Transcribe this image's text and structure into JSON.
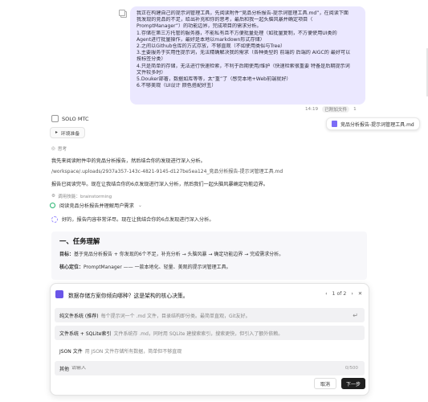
{
  "user_message": {
    "lines": [
      "我正在构建自己的提示词管理工具，先阅读附件“竞品分析报告-提示词管理工具.md”，在阅读下面",
      "我发现的竞品的不足，给出补充和你的思考，最后和我一起头脑风暴并确定项目（",
      "PromptManager”）的功能边界，完成项目的需求分析。",
      "1.存储在第三方托管的服务器，不能私有且不方便批量处理（如批量复制，不方便使用UI类的",
      "Agent进行批量操作，最好是本地以markdown形式存储）",
      "2.之间以Github仓库的方式存放，不够直观（不如使用类似与Tree）",
      "3.主要服务于实用性提示词，无法精确解决我的需求（各种类型的 前端的 后端的 AIGC的 最好可以",
      "按标签分类）",
      "4.只是简单的存储，无法进行快速检索，不利于后期使用/维护（快速检索很重要 特备是后期提示词",
      "文件较多时）",
      "5.Douker部署，数据如库等等，太“重”了（感觉本地+Web前端就好）",
      "6.不够美观（UI设计 颜色搭配好丑）"
    ],
    "time": "14:19",
    "badge": "已附加文件",
    "count": "1",
    "attachment": "竞品分析报告-提示词管理工具.md"
  },
  "assistant": {
    "brand": "SOLO MTC",
    "env_label": "环境准备",
    "think_label": "思考",
    "intro": "我先来阅读附件中的竞品分析报告，然后结合你的发现进行深入分析。",
    "path": "/workspace/.uploads/2937a357-143c-4821-9145-d127be5ea124_竞品分析报告-提示词管理工具.md",
    "report_line": "报告已阅读完毕。现在让我结合你的6点发现进行深入分析，然后我们一起头脑风暴确定功能边界。",
    "tool_label": "调用技能：brainstorming",
    "task_label": "阅读竞品分析报告并理解用户需求",
    "progress_label": "好的，报告内容非常详尽。现在让我结合你的6点发现进行深入分析。",
    "doc": {
      "heading": "一、任务理解",
      "goal_label": "目标：",
      "goal_text": "基于竞品分析报告 + 你发现的6个不足，补充分析 → 头脑风暴 → 确定功能边界 → 完成需求分析。",
      "core_label": "核心定位：",
      "core_text": "PromptManager —— 一款本地化、轻量、美观的提示词管理工具。"
    }
  },
  "question": {
    "title": "数据存储方案你倾向哪种？这是架构的核心决策。",
    "pager": "1 of 2",
    "options": [
      {
        "title": "纯文件系统 (推荐)",
        "desc": "每个提示词一个 .md 文件，目录结构即分类。最简单直观，Git友好。"
      },
      {
        "title": "文件系统 + SQLite索引",
        "desc": "文件系统存 .md，同时用 SQLite 建搜索索引，搜索更快，但引入了额外依赖。"
      },
      {
        "title": "JSON 文件",
        "desc": "用 JSON 文件存储所有数据，简单但不够直观"
      }
    ],
    "other_label": "其他",
    "other_placeholder": "请输入",
    "counter": "0/500",
    "cancel": "取消",
    "next": "下一步"
  }
}
